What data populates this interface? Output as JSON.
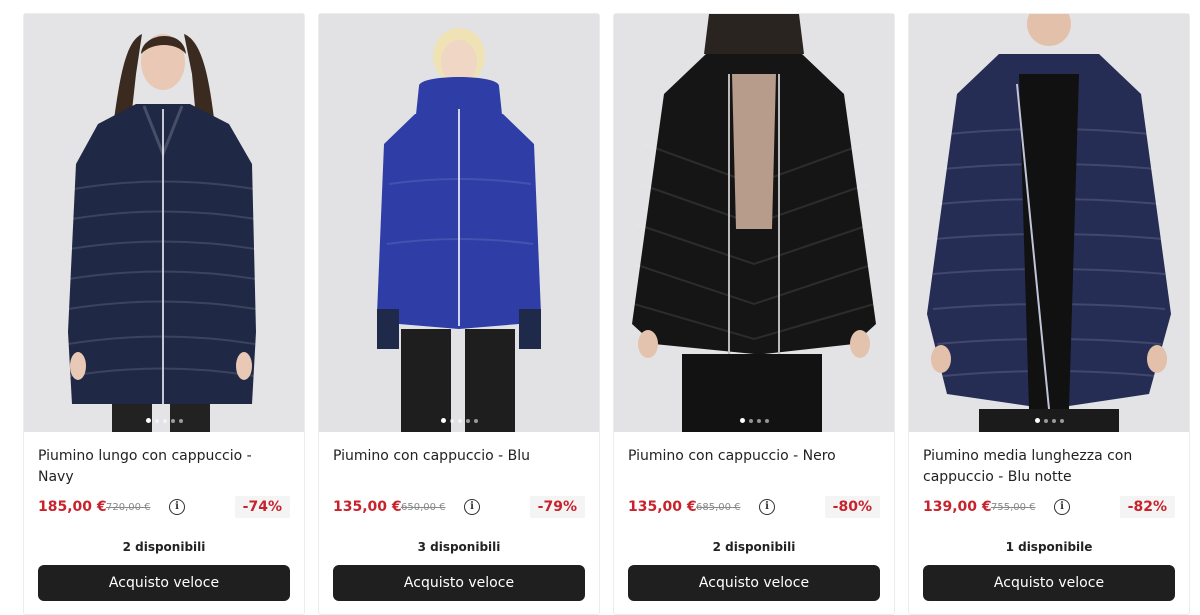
{
  "products": [
    {
      "title": "Piumino lungo con cappuccio - Navy",
      "price": "185,00 €",
      "old_price": "720,00 €",
      "discount": "-74%",
      "stock": "2 disponibili",
      "button": "Acquisto veloce",
      "coat_color": "#1f2845",
      "image_slide": "1/5"
    },
    {
      "title": "Piumino con cappuccio - Blu",
      "price": "135,00 €",
      "old_price": "650,00 €",
      "discount": "-79%",
      "stock": "3 disponibili",
      "button": "Acquisto veloce",
      "coat_color": "#2f3ea6",
      "image_slide": "1/5"
    },
    {
      "title": "Piumino con cappuccio - Nero",
      "price": "135,00 €",
      "old_price": "685,00 €",
      "discount": "-80%",
      "stock": "2 disponibili",
      "button": "Acquisto veloce",
      "coat_color": "#151515",
      "image_slide": "1/4"
    },
    {
      "title": "Piumino media lunghezza con cappuccio - Blu notte",
      "price": "139,00 €",
      "old_price": "755,00 €",
      "discount": "-82%",
      "stock": "1 disponibile",
      "button": "Acquisto veloce",
      "coat_color": "#252d55",
      "image_slide": "1/4"
    }
  ],
  "info_icon": "info-circle-icon",
  "colors": {
    "price": "#c8232c",
    "button_bg": "#1f1f1f",
    "discount_bg": "#f4f4f4"
  }
}
